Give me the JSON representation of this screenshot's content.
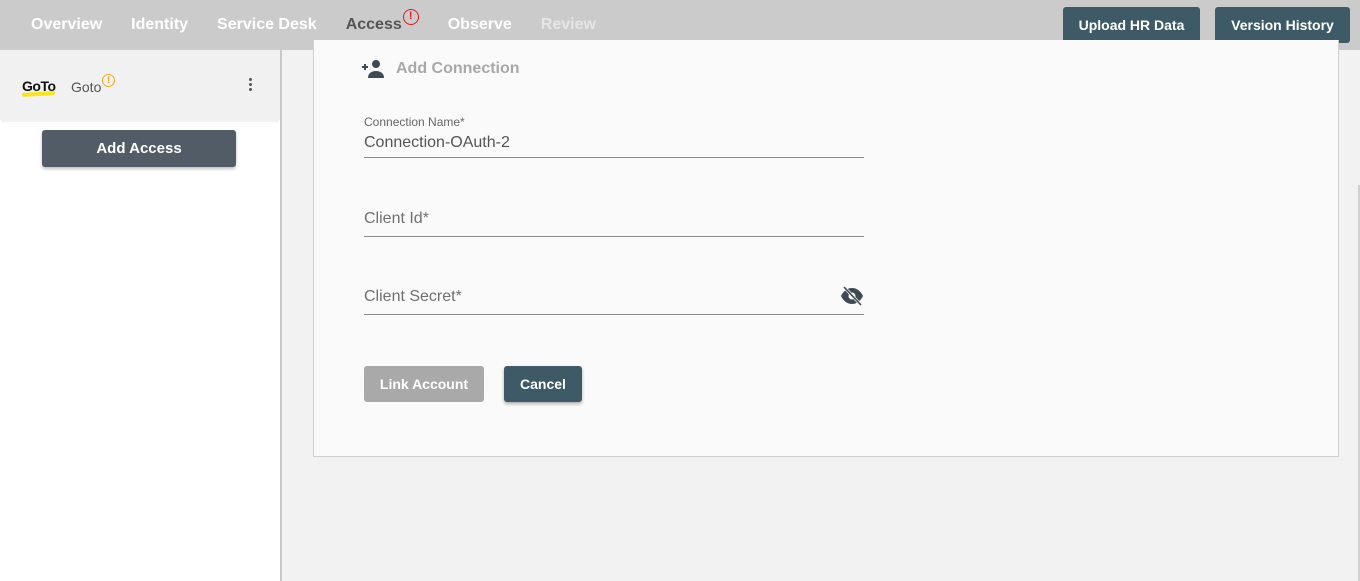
{
  "nav": {
    "items": [
      {
        "label": "Overview",
        "state": "normal"
      },
      {
        "label": "Identity",
        "state": "normal"
      },
      {
        "label": "Service Desk",
        "state": "normal"
      },
      {
        "label": "Access",
        "state": "active",
        "badge": "!"
      },
      {
        "label": "Observe",
        "state": "normal"
      },
      {
        "label": "Review",
        "state": "disabled"
      }
    ],
    "upload_label": "Upload HR Data",
    "version_label": "Version History"
  },
  "sidebar": {
    "app": {
      "logo_text": "GoTo",
      "name": "Goto",
      "warning": "!"
    },
    "add_access_label": "Add Access"
  },
  "form": {
    "title": "Add Connection",
    "connection_name": {
      "label": "Connection Name*",
      "value": "Connection-OAuth-2"
    },
    "client_id": {
      "placeholder": "Client Id*",
      "value": ""
    },
    "client_secret": {
      "placeholder": "Client Secret*",
      "value": ""
    },
    "link_label": "Link Account",
    "cancel_label": "Cancel"
  },
  "colors": {
    "primary": "#3d5a66",
    "disabled": "#a9a9a9",
    "error": "#e01b1b",
    "warning": "#f5a623"
  }
}
